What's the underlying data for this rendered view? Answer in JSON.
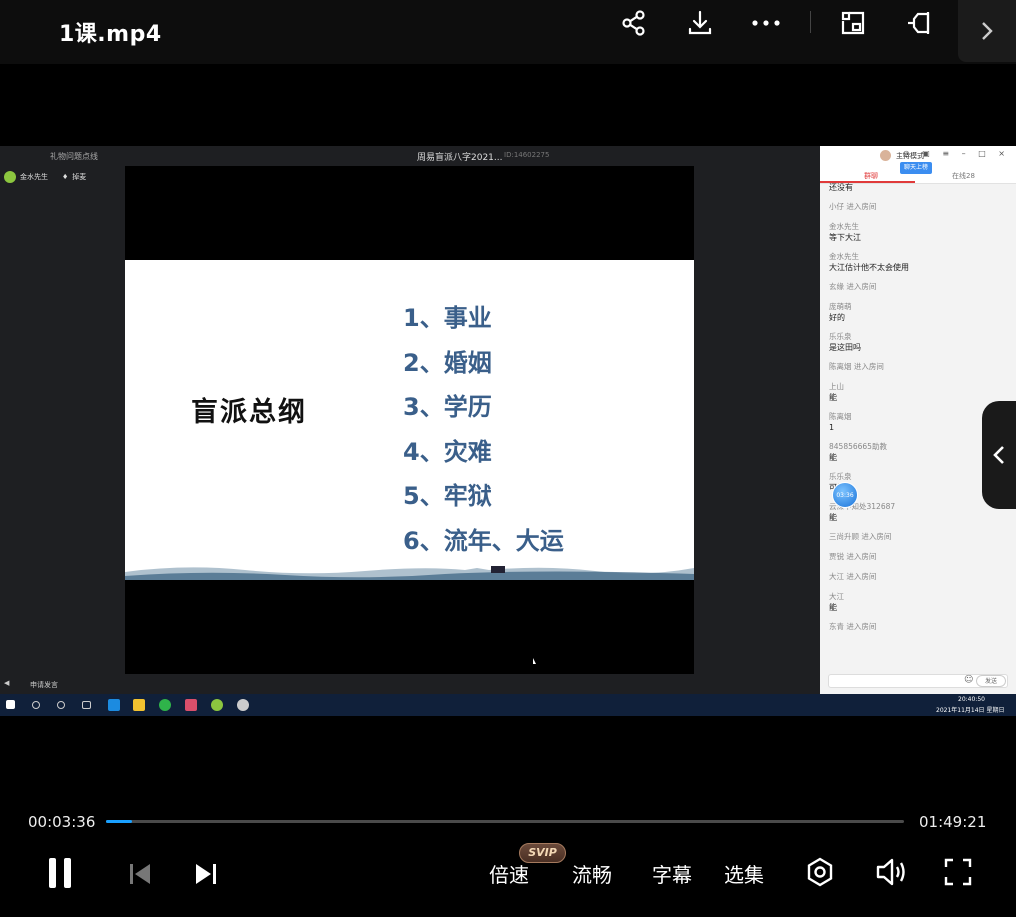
{
  "header": {
    "title": "1课.mp4",
    "icons": [
      "share-icon",
      "download-icon",
      "more-icon",
      "picture-in-picture-icon",
      "pin-icon",
      "chevron-right-icon"
    ]
  },
  "capture": {
    "top_bar": {
      "gift_text": "礼物问题点线",
      "room_title": "周易盲派八字2021...",
      "room_id": "ID:14602275"
    },
    "host_row": {
      "name": "金水先生",
      "mic_label": "掉麦"
    },
    "slide": {
      "title": "盲派总纲",
      "items": [
        "1、事业",
        "2、婚姻",
        "3、学历",
        "4、灾难",
        "5、牢狱",
        "6、流年、大运"
      ]
    },
    "bottom_bar": {
      "call_label": "申请发言"
    },
    "chat": {
      "mode_label": "主持模式",
      "tab_chat": "群聊",
      "tab_online": "在线28",
      "tip_label": "聊天上榜",
      "messages": [
        {
          "name": "",
          "text": "还没有"
        },
        {
          "name": "小仔 进入房间",
          "text": ""
        },
        {
          "name": "金水先生",
          "text": "等下大江"
        },
        {
          "name": "金水先生",
          "text": "大江估计他不太会使用"
        },
        {
          "name": "玄缘 进入房间",
          "text": ""
        },
        {
          "name": "庞萌萌",
          "text": "好的"
        },
        {
          "name": "乐乐泉",
          "text": "是这田吗"
        },
        {
          "name": "陈离烟 进入房间",
          "text": ""
        },
        {
          "name": "上山",
          "text": "能"
        },
        {
          "name": "陈离烟",
          "text": "1"
        },
        {
          "name": "845856665助教",
          "text": "能"
        },
        {
          "name": "乐乐泉",
          "text": "可以"
        },
        {
          "name": "云深不知处312687",
          "text": "能"
        },
        {
          "name": "三尚升顾 进入房间",
          "text": ""
        },
        {
          "name": "贾锐 进入房间",
          "text": ""
        },
        {
          "name": "大江 进入房间",
          "text": ""
        },
        {
          "name": "大江",
          "text": "能"
        },
        {
          "name": "东青 进入房间",
          "text": ""
        }
      ],
      "send_label": "发送",
      "bubble_time": "03:36"
    },
    "taskbar": {
      "time": "20:40:50",
      "date": "2021年11月14日 星期日"
    }
  },
  "player": {
    "current_time": "00:03:36",
    "total_time": "01:49:21",
    "progress": 0.033,
    "speed_label": "倍速",
    "svip_badge": "SVIP",
    "quality_label": "流畅",
    "subtitle_label": "字幕",
    "episodes_label": "选集"
  },
  "colors": {
    "progress_fill": "#19a0ff",
    "slide_text": "#3a5f8a",
    "chat_active": "#e03a3a"
  }
}
